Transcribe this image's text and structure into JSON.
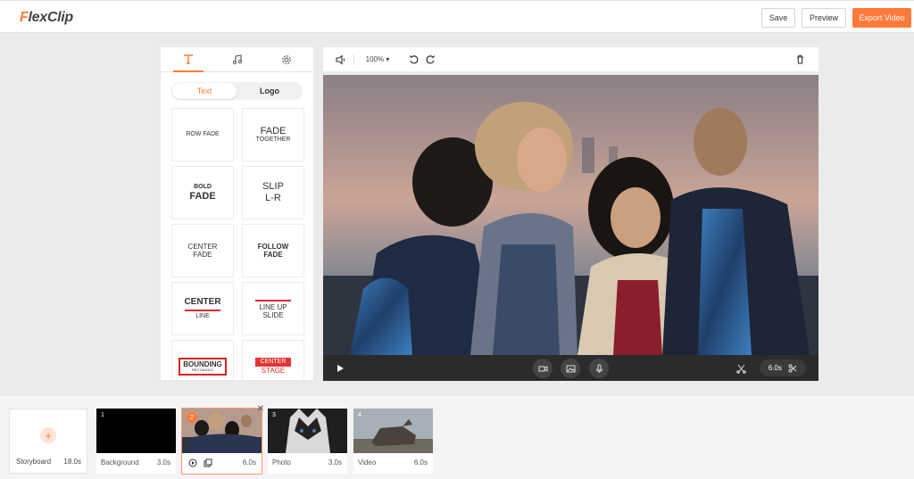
{
  "app": {
    "logo": "FlexClip"
  },
  "header": {
    "save": "Save",
    "preview": "Preview",
    "export": "Export Video"
  },
  "left_panel": {
    "tabs": [
      "text-icon",
      "music-icon",
      "gear-icon"
    ],
    "segment": {
      "active": "Text",
      "other": "Logo"
    },
    "templates": [
      {
        "l1": "ROW FADE",
        "l2": ""
      },
      {
        "l1": "FADE",
        "l2": "TOGETHER"
      },
      {
        "l1": "BOLD",
        "l2": "FADE"
      },
      {
        "l1": "SLIP",
        "l2": "L-R"
      },
      {
        "l1": "CENTER",
        "l2": "FADE"
      },
      {
        "l1": "FOLLOW",
        "l2": "FADE"
      },
      {
        "l1": "CENTER",
        "l2": "LINE"
      },
      {
        "l1": "LINE UP",
        "l2": "SLIDE"
      },
      {
        "l1": "BOUNDING",
        "l2": "RECTANGLE"
      },
      {
        "l1": "CENTER",
        "l2": "STAGE"
      }
    ]
  },
  "preview": {
    "zoom": "100% ▾",
    "clip_duration": "6.0s"
  },
  "storyboard": {
    "label": "Storyboard",
    "total": "18.0s",
    "clips": [
      {
        "num": "1",
        "label": "Background",
        "duration": "3.0s"
      },
      {
        "num": "2",
        "label": "",
        "duration": "6.0s"
      },
      {
        "num": "3",
        "label": "Photo",
        "duration": "3.0s"
      },
      {
        "num": "4",
        "label": "Video",
        "duration": "6.0s"
      }
    ]
  },
  "colors": {
    "accent": "#ff7a3a",
    "danger": "#e02a2a"
  }
}
